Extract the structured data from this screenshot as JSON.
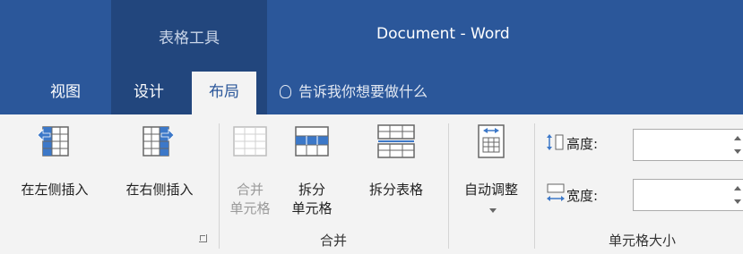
{
  "title_bar": {
    "context_group": "表格工具",
    "document_title": "Document - Word"
  },
  "tabs": [
    {
      "label": "视图",
      "active": false
    },
    {
      "label": "设计",
      "active": false
    },
    {
      "label": "布局",
      "active": true
    }
  ],
  "tell_me": {
    "placeholder": "告诉我你想要做什么"
  },
  "ribbon": {
    "insert_left": "在左侧插入",
    "insert_right": "在右侧插入",
    "merge_cells_line1": "合并",
    "merge_cells_line2": "单元格",
    "split_cells_line1": "拆分",
    "split_cells_line2": "单元格",
    "split_table": "拆分表格",
    "autofit": "自动调整",
    "height_label": "高度:",
    "width_label": "宽度:",
    "height_value": "",
    "width_value": "",
    "group_merge": "合并",
    "group_cell_size": "单元格大小"
  },
  "colors": {
    "title_blue": "#2b579a",
    "context_blue": "#22467d",
    "accent_blue": "#3c78c8"
  }
}
